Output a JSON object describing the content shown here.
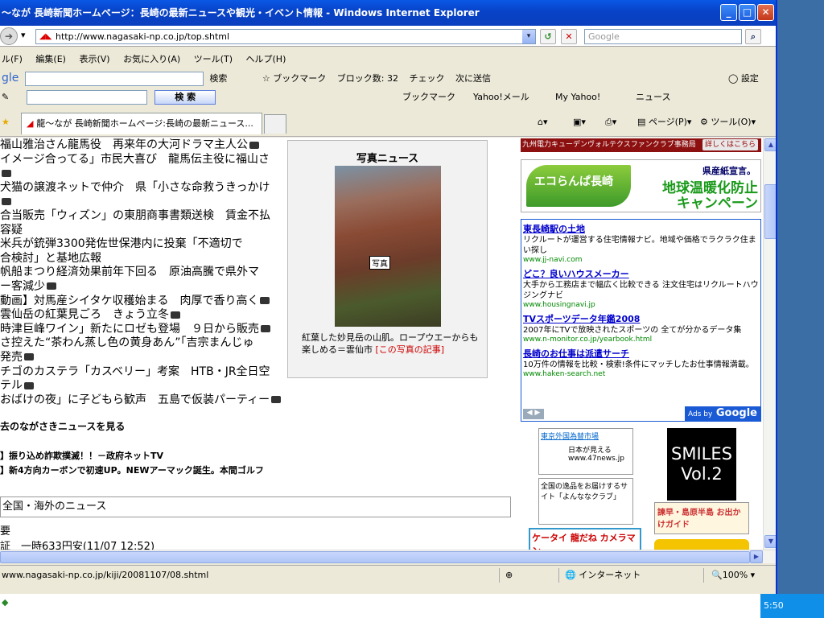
{
  "window": {
    "title": "〜なが 長崎新聞ホームページ：長崎の最新ニュースや観光・イベント情報 - Windows Internet Explorer"
  },
  "address": {
    "url": "http://www.nagasaki-np.co.jp/top.shtml",
    "search_placeholder": "Google"
  },
  "menu": [
    "ル(F)",
    "編集(E)",
    "表示(V)",
    "お気に入り(A)",
    "ツール(T)",
    "ヘルプ(H)"
  ],
  "google_toolbar": {
    "logo": "gle",
    "search": "検索",
    "bookmarks": "ブックマーク",
    "blocked": "ブロック数: 32",
    "check": "チェック",
    "send": "次に送信",
    "settings": "設定"
  },
  "yahoo_toolbar": {
    "search_button": "検 索",
    "bookmarks": "ブックマーク",
    "mail": "Yahoo!メール",
    "myyahoo": "My Yahoo!",
    "news": "ニュース"
  },
  "tab": {
    "label": "龍〜なが 長崎新聞ホームページ:長崎の最新ニュース...",
    "page": "ページ(P)",
    "tools": "ツール(O)"
  },
  "news": [
    "福山雅治さん龍馬役　再来年の大河ドラマ主人公",
    "イメージ合ってる」市民大喜び　龍馬伝主役に福山さ",
    "犬猫の譲渡ネットで仲介　県「小さな命救うきっかけ",
    "合当販売「ウィズン」の東朋商事書類送検　賃金不払",
    "容疑",
    "米兵が銃弾3300発佐世保港内に投棄「不適切で",
    "合検討」と基地広報",
    "帆船まつり経済効果前年下回る　原油高騰で県外マ",
    "ー客減少",
    "動画】対馬産シイタケ収穫始まる　肉厚で香り高く",
    "雲仙岳の紅葉見ごろ　きょう立冬",
    "時津巨峰ワイン」新たにロゼも登場　９日から販売",
    "さ控えた“茶わん蒸し色の黄身あん”「吉宗まんじゅ",
    "発売",
    "チゴのカステラ「カスベリー」考案　HTB・JR全日空",
    "テル",
    "おばけの夜」に子どもら歓声　五島で仮装パーティー"
  ],
  "past_news": "去のながさきニュースを見る",
  "promos": [
    "】振り込め詐欺撲滅！！－政府ネットTV",
    "】新4方向カーボンで初速UP。NEWアーマック誕生。本間ゴルフ"
  ],
  "section": {
    "title": "全国・海外のニュース",
    "sub1": "要",
    "sub2": "証　一時633円安(11/07 12:52)"
  },
  "photo": {
    "heading": "写真ニュース",
    "label": "写真",
    "caption": "紅葉した妙見岳の山肌。ロープウエーからも楽しめる＝雲仙市 ",
    "link": "[この写真の記事]"
  },
  "sidebar": {
    "kyuden": "九州電力キューデンヴォルテクスファンクラブ事務局",
    "kyuden_btn": "詳しくはこちら",
    "eco": {
      "leaf": "エコらんぱ長崎",
      "pref": "県産紙宣言。",
      "line1": "地球温暖化防止",
      "line2": "キャンペーン"
    },
    "ads": [
      {
        "title": "東長崎駅の土地",
        "desc": "リクルートが運営する住宅情報ナビ。地域や価格でラクラク住まい探し",
        "url": "www.jj-navi.com"
      },
      {
        "title": "どこ？良いハウスメーカー",
        "desc": "大手から工務店まで幅広く比較できる 注文住宅はリクルートハウジングナビ",
        "url": "www.housingnavi.jp"
      },
      {
        "title": "TVスポーツデータ年鑑2008",
        "desc": "2007年にTVで放映されたスポーツの 全てが分かるデータ集",
        "url": "www.n-monitor.co.jp/yearbook.html"
      },
      {
        "title": "長崎のお仕事は派遣サーチ",
        "desc": "10万件の情報を比較・検索!条件にマッチしたお仕事情報満載。",
        "url": "www.haken-search.net"
      }
    ],
    "ads_by": "Ads by",
    "ads_google": "Google",
    "b1": "東京外国為替市場",
    "b1b": "日本が見える www.47news.jp",
    "b2": "全国の逸品をお届けするサイト「よんななクラブ」",
    "smiles": [
      "SMILES",
      "Vol.2"
    ],
    "b3": "諫早・島原半島 お出かけガイド",
    "b4": "ケータイ 龍だね カメラマン"
  },
  "status": {
    "url": "www.nagasaki-np.co.jp/kiji/20081107/08.shtml",
    "zone": "インターネット",
    "zoom": "100%"
  },
  "clock": "5:50"
}
